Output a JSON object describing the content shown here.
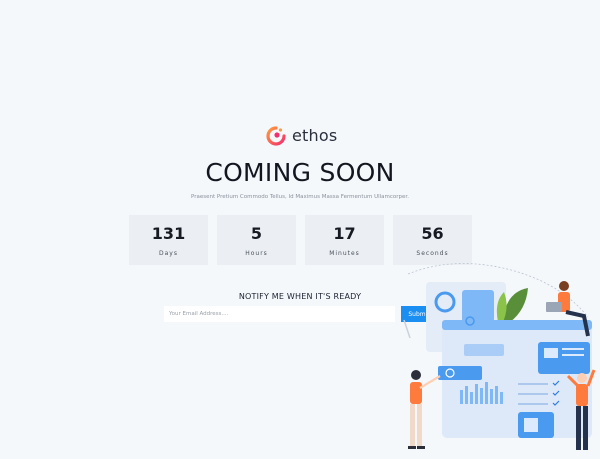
{
  "brand": {
    "name": "ethos"
  },
  "hero": {
    "title": "COMING SOON",
    "subtitle": "Praesent Pretium Commodo Tellus, Id Maximus Massa Fermentum Ullamcorper."
  },
  "countdown": [
    {
      "value": "131",
      "label": "Days"
    },
    {
      "value": "5",
      "label": "Hours"
    },
    {
      "value": "17",
      "label": "Minutes"
    },
    {
      "value": "56",
      "label": "Seconds"
    }
  ],
  "notify": {
    "title": "NOTIFY ME WHEN IT'S READY",
    "placeholder": "Your Email Address....",
    "value": "",
    "submit_label": "Submit"
  },
  "colors": {
    "background": "#f5f8fb",
    "accent": "#1b8ef2",
    "logo_gradient_start": "#f8557e",
    "logo_gradient_end": "#ff9a3d",
    "box": "#ebeff3"
  },
  "illustration": {
    "icon": "dashboard-people-illustration"
  }
}
